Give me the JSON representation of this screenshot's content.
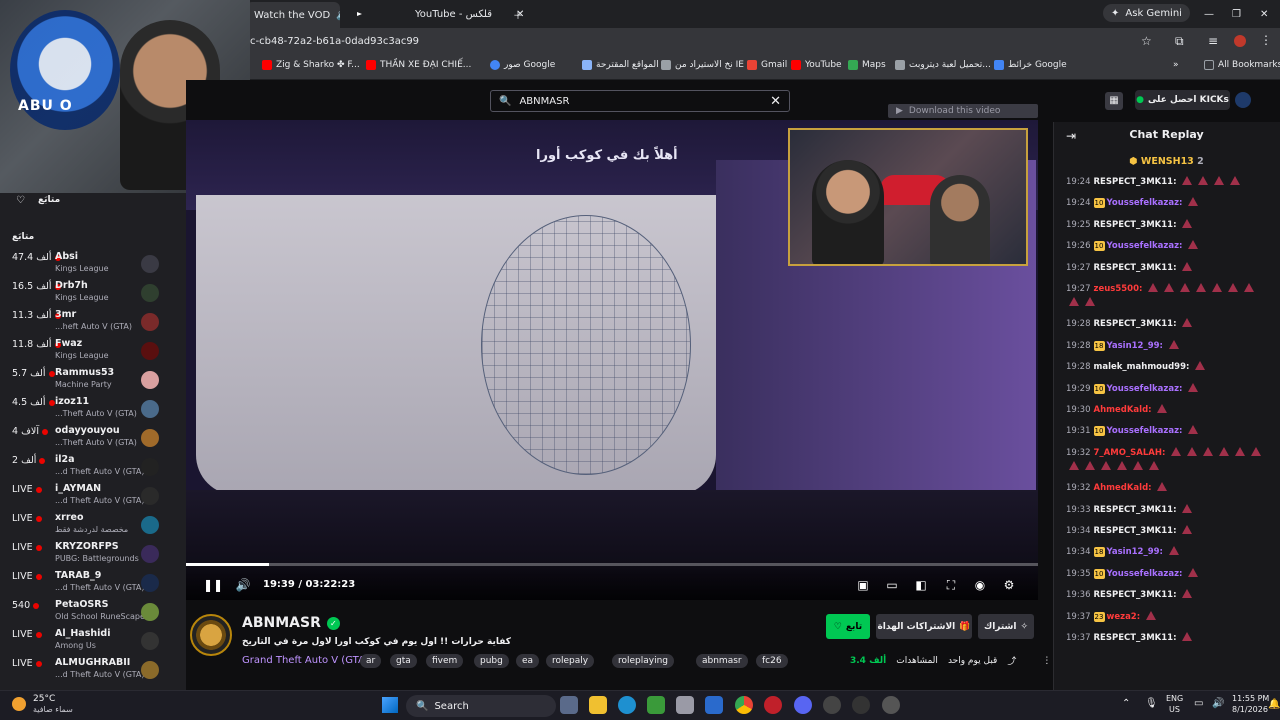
{
  "browser": {
    "tabs": [
      {
        "title": "Watch the VOD",
        "active": true
      },
      {
        "title": "YouTube - قلكس",
        "active": false
      }
    ],
    "ask_gemini": "Ask Gemini",
    "url": "c-cb48-72a2-b61a-0dad93c3ac99",
    "bookmarks": [
      "Zig & Sharko ✤ F...",
      "THẦN XE ĐẠI CHIẾ...",
      "صور Google",
      "المواقع المقترحة",
      "نخ الاستيراد من IE",
      "Gmail",
      "YouTube",
      "Maps",
      "تحميل لعبة ديتروبت...",
      "خرائط Google"
    ],
    "all_bookmarks": "All Bookmarks"
  },
  "webcam": {
    "brand_text": "ABU O"
  },
  "sidebar": {
    "heading_top": "متابَع",
    "heading": "متابَع",
    "channels": [
      {
        "count": "47.4 ألف",
        "name": "Absi",
        "game": "Kings League",
        "avatar_color": "#3a3a44"
      },
      {
        "count": "16.5 ألف",
        "name": "Drb7h",
        "game": "Kings League",
        "avatar_color": "#2f3f2f"
      },
      {
        "count": "11.3 ألف",
        "name": "3mr",
        "game": "...heft Auto V (GTA)",
        "avatar_color": "#7a2a2a"
      },
      {
        "count": "11.8 ألف",
        "name": "Fwaz",
        "game": "Kings League",
        "avatar_color": "#5a0f0f"
      },
      {
        "count": "5.7 ألف",
        "name": "Rammus53",
        "game": "Machine Party",
        "avatar_color": "#d9a0a0"
      },
      {
        "count": "4.5 ألف",
        "name": "izoz11",
        "game": "...Theft Auto V (GTA)",
        "avatar_color": "#4a6a8a"
      },
      {
        "count": "4 آلاف",
        "name": "odayyouyou",
        "game": "...Theft Auto V (GTA)",
        "avatar_color": "#a06a2a"
      },
      {
        "count": "2 ألف",
        "name": "il2a",
        "game": "...d Theft Auto V (GTA)",
        "avatar_color": "#222222"
      },
      {
        "count": "LIVE",
        "name": "i_AYMAN",
        "game": "...d Theft Auto V (GTA)",
        "avatar_color": "#2a2a2a"
      },
      {
        "count": "LIVE",
        "name": "xrreo",
        "game": "مخصصة لدردشة فقط",
        "avatar_color": "#1a6a8a"
      },
      {
        "count": "LIVE",
        "name": "KRYZORFPS",
        "game": "PUBG: Battlegrounds",
        "avatar_color": "#3a2a5a"
      },
      {
        "count": "LIVE",
        "name": "TARAB_9",
        "game": "...d Theft Auto V (GTA)",
        "avatar_color": "#1a2a4a"
      },
      {
        "count": "540",
        "name": "PetaOSRS",
        "game": "Old School RuneScape",
        "avatar_color": "#6a8a3a"
      },
      {
        "count": "LIVE",
        "name": "Al_Hashidi",
        "game": "Among Us",
        "avatar_color": "#333333"
      },
      {
        "count": "LIVE",
        "name": "ALMUGHRABII",
        "game": "...d Theft Auto V (GTA)",
        "avatar_color": "#8a6a2a"
      }
    ]
  },
  "player": {
    "search_value": "ABNMASR",
    "download_label": "Download this video",
    "welcome_text": "أهلاً بك في كوكب أورا",
    "time": "19:39 / 03:22:23",
    "progress": 0.097
  },
  "channel_info": {
    "name": "ABNMASR",
    "title": "كفاية حرارات !! اول يوم في كوكب اورا لاول مرة في التاريخ",
    "game": "Grand Theft Auto V (GTA)",
    "tags": [
      "ar",
      "gta",
      "fivem",
      "pubg",
      "ea",
      "rolepaly",
      "roleplaying",
      "abnmasr",
      "fc26"
    ],
    "follow_label": "تابع",
    "gift_label": "الاشتراكات الهداة",
    "subscribe_label": "اشتراك",
    "views_label": "المشاهدات",
    "views": "3.4 ألف",
    "ago": "قبل يوم واحد"
  },
  "chat": {
    "kicks_label": "احصل على KICKs",
    "title": "Chat Replay",
    "pinned_user": "WENSH13",
    "pinned_count": "2",
    "messages": [
      {
        "time": "19:24",
        "user": "RESPECT_3MK11:",
        "color": "#efeff1",
        "sub": "",
        "emotes": 4
      },
      {
        "time": "19:24",
        "user": "Youssefelkazaz:",
        "color": "#a970ff",
        "sub": "10",
        "emotes": 1
      },
      {
        "time": "19:25",
        "user": "RESPECT_3MK11:",
        "color": "#efeff1",
        "sub": "",
        "emotes": 1
      },
      {
        "time": "19:26",
        "user": "Youssefelkazaz:",
        "color": "#a970ff",
        "sub": "10",
        "emotes": 1
      },
      {
        "time": "19:27",
        "user": "RESPECT_3MK11:",
        "color": "#efeff1",
        "sub": "",
        "emotes": 1
      },
      {
        "time": "19:27",
        "user": "zeus5500:",
        "color": "#ff3b3b",
        "sub": "",
        "emotes": 9
      },
      {
        "time": "19:28",
        "user": "RESPECT_3MK11:",
        "color": "#efeff1",
        "sub": "",
        "emotes": 1
      },
      {
        "time": "19:28",
        "user": "Yasin12_99:",
        "color": "#a970ff",
        "sub": "18",
        "emotes": 1
      },
      {
        "time": "19:28",
        "user": "malek_mahmoud99:",
        "color": "#efeff1",
        "sub": "",
        "emotes": 1
      },
      {
        "time": "19:29",
        "user": "Youssefelkazaz:",
        "color": "#a970ff",
        "sub": "10",
        "emotes": 1
      },
      {
        "time": "19:30",
        "user": "AhmedKald:",
        "color": "#ff3b3b",
        "sub": "",
        "emotes": 1
      },
      {
        "time": "19:31",
        "user": "Youssefelkazaz:",
        "color": "#a970ff",
        "sub": "10",
        "emotes": 1
      },
      {
        "time": "19:32",
        "user": "7_AMO_SALAH:",
        "color": "#ff3b3b",
        "sub": "",
        "emotes": 12
      },
      {
        "time": "19:32",
        "user": "AhmedKald:",
        "color": "#ff3b3b",
        "sub": "",
        "emotes": 1
      },
      {
        "time": "19:33",
        "user": "RESPECT_3MK11:",
        "color": "#efeff1",
        "sub": "",
        "emotes": 1
      },
      {
        "time": "19:34",
        "user": "RESPECT_3MK11:",
        "color": "#efeff1",
        "sub": "",
        "emotes": 1
      },
      {
        "time": "19:34",
        "user": "Yasin12_99:",
        "color": "#a970ff",
        "sub": "18",
        "emotes": 1
      },
      {
        "time": "19:35",
        "user": "Youssefelkazaz:",
        "color": "#a970ff",
        "sub": "10",
        "emotes": 1
      },
      {
        "time": "19:36",
        "user": "RESPECT_3MK11:",
        "color": "#efeff1",
        "sub": "",
        "emotes": 1
      },
      {
        "time": "19:37",
        "user": "weza2:",
        "color": "#ff3b3b",
        "sub": "23",
        "emotes": 1
      },
      {
        "time": "19:37",
        "user": "RESPECT_3MK11:",
        "color": "#efeff1",
        "sub": "",
        "emotes": 1
      }
    ]
  },
  "taskbar": {
    "weather_temp": "25°C",
    "weather_text": "سماء صافية",
    "search": "Search",
    "lang": "ENG",
    "region": "US",
    "time": "11:55 PM",
    "date": "8/1/2026"
  }
}
